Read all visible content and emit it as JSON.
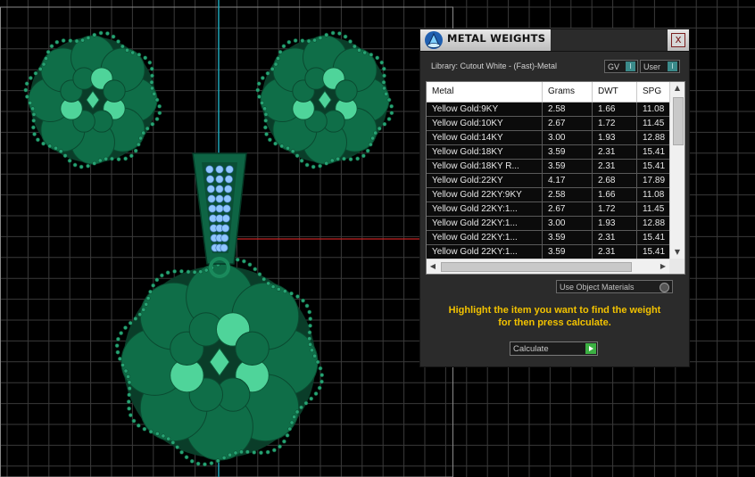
{
  "viewport": {
    "name": "3d-viewport"
  },
  "panel": {
    "title": "METAL WEIGHTS",
    "close_label": "x",
    "library_label": "Library: Cutout White - (Fast)-Metal",
    "toggles": [
      {
        "label": "GV",
        "indicator": "I"
      },
      {
        "label": "User",
        "indicator": "I"
      }
    ],
    "table": {
      "columns": [
        "Metal",
        "Grams",
        "DWT",
        "SPG"
      ],
      "rows": [
        [
          "Yellow Gold:9KY",
          "2.58",
          "1.66",
          "11.08"
        ],
        [
          "Yellow Gold:10KY",
          "2.67",
          "1.72",
          "11.45"
        ],
        [
          "Yellow Gold:14KY",
          "3.00",
          "1.93",
          "12.88"
        ],
        [
          "Yellow Gold:18KY",
          "3.59",
          "2.31",
          "15.41"
        ],
        [
          "Yellow Gold:18KY R...",
          "3.59",
          "2.31",
          "15.41"
        ],
        [
          "Yellow Gold:22KY",
          "4.17",
          "2.68",
          "17.89"
        ],
        [
          "Yellow Gold 22KY:9KY",
          "2.58",
          "1.66",
          "11.08"
        ],
        [
          "Yellow Gold 22KY:1...",
          "2.67",
          "1.72",
          "11.45"
        ],
        [
          "Yellow Gold 22KY:1...",
          "3.00",
          "1.93",
          "12.88"
        ],
        [
          "Yellow Gold 22KY:1...",
          "3.59",
          "2.31",
          "15.41"
        ],
        [
          "Yellow Gold 22KY:1...",
          "3.59",
          "2.31",
          "15.41"
        ]
      ]
    },
    "use_object_materials": "Use Object Materials",
    "hint_lines": [
      "Highlight the item you want to find the weight",
      "for then press calculate."
    ],
    "calculate_label": "Calculate"
  },
  "colors": {
    "accent_hint": "#f2c200",
    "jewel": "#1a8a5c",
    "stones": "#6fb8ff"
  }
}
